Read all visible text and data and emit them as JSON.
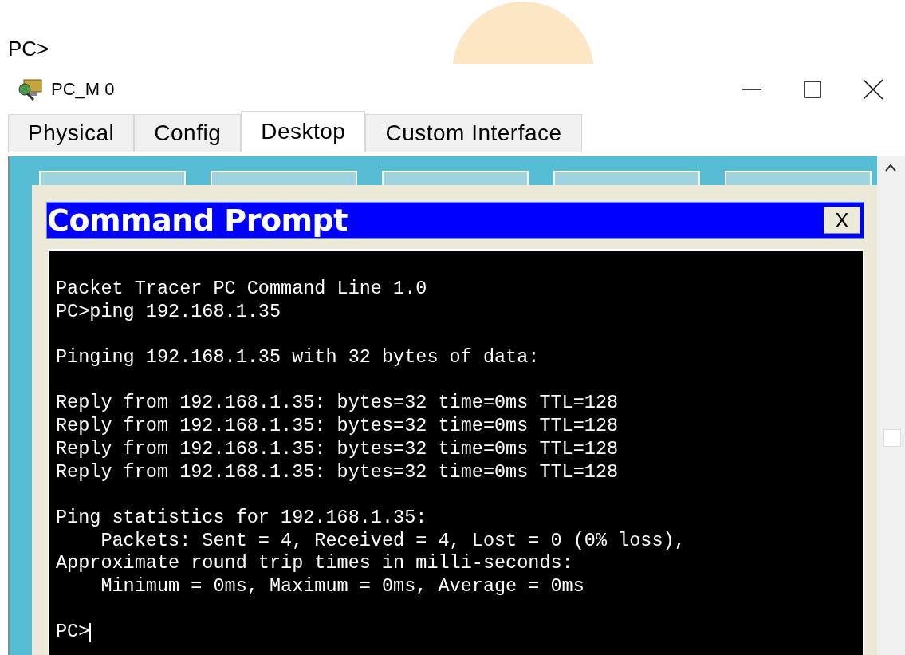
{
  "top_text": "PC>",
  "window": {
    "title": "PC_M 0"
  },
  "tabs": [
    {
      "label": "Physical",
      "selected": false
    },
    {
      "label": "Config",
      "selected": false
    },
    {
      "label": "Desktop",
      "selected": true
    },
    {
      "label": "Custom Interface",
      "selected": false
    }
  ],
  "command_prompt": {
    "title": "Command Prompt",
    "close_label": "X",
    "blocks": [
      [
        "Packet Tracer PC Command Line 1.0",
        "PC>ping 192.168.1.35"
      ],
      [
        "Pinging 192.168.1.35 with 32 bytes of data:"
      ],
      [
        "Reply from 192.168.1.35: bytes=32 time=0ms TTL=128",
        "Reply from 192.168.1.35: bytes=32 time=0ms TTL=128",
        "Reply from 192.168.1.35: bytes=32 time=0ms TTL=128",
        "Reply from 192.168.1.35: bytes=32 time=0ms TTL=128"
      ],
      [
        "Ping statistics for 192.168.1.35:",
        "    Packets: Sent = 4, Received = 4, Lost = 0 (0% loss),",
        "Approximate round trip times in milli-seconds:",
        "    Minimum = 0ms, Maximum = 0ms, Average = 0ms"
      ]
    ],
    "prompt": "PC>"
  }
}
